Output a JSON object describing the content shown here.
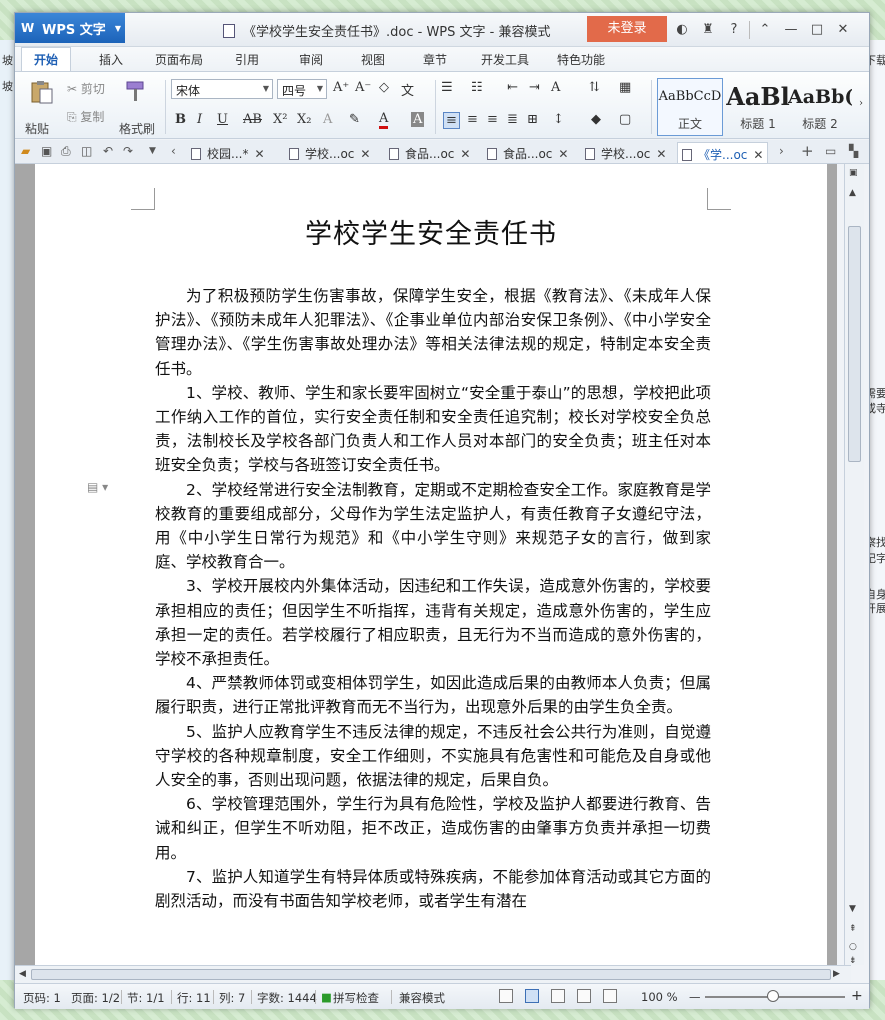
{
  "desktop": {
    "left_strip": [
      "坡",
      "坡"
    ],
    "right_strip": [
      "下载",
      "需要",
      "或寺",
      "察找",
      "记字",
      "自身",
      "开展"
    ]
  },
  "titlebar": {
    "app_name": "WPS 文字",
    "document_title": "《学校学生安全责任书》.doc - WPS 文字 - 兼容模式",
    "login_button": "未登录",
    "help_label": "?"
  },
  "menu": {
    "tabs": [
      "开始",
      "插入",
      "页面布局",
      "引用",
      "审阅",
      "视图",
      "章节",
      "开发工具",
      "特色功能"
    ],
    "active_tab": "开始"
  },
  "ribbon": {
    "paste": "粘贴",
    "cut": "剪切",
    "copy": "复制",
    "format_painter": "格式刷",
    "font_name": "宋体",
    "font_size": "四号",
    "styles": [
      {
        "sample": "AaBbCcD",
        "name": "正文"
      },
      {
        "sample": "AaBl",
        "name": "标题 1"
      },
      {
        "sample": "AaBb(",
        "name": "标题 2"
      }
    ]
  },
  "doc_tabs": [
    {
      "label": "校园...*",
      "active": false
    },
    {
      "label": "学校...oc",
      "active": false
    },
    {
      "label": "食品...oc",
      "active": false
    },
    {
      "label": "食品...oc",
      "active": false
    },
    {
      "label": "学校...oc",
      "active": false
    },
    {
      "label": "《学...oc",
      "active": true
    }
  ],
  "document": {
    "title": "学校学生安全责任书",
    "paragraphs": [
      "为了积极预防学生伤害事故，保障学生安全，根据《教育法》、《未成年人保护法》、《预防未成年人犯罪法》、《企事业单位内部治安保卫条例》、《中小学安全管理办法》、《学生伤害事故处理办法》等相关法律法规的规定，特制定本安全责任书。",
      "1、学校、教师、学生和家长要牢固树立“安全重于泰山”的思想，学校把此项工作纳入工作的首位，实行安全责任制和安全责任追究制；校长对学校安全负总责，法制校长及学校各部门负责人和工作人员对本部门的安全负责；班主任对本班安全负责；学校与各班签订安全责任书。",
      "2、学校经常进行安全法制教育，定期或不定期检查安全工作。家庭教育是学校教育的重要组成部分，父母作为学生法定监护人，有责任教育子女遵纪守法，用《中小学生日常行为规范》和《中小学生守则》来规范子女的言行，做到家庭、学校教育合一。",
      "3、学校开展校内外集体活动，因违纪和工作失误，造成意外伤害的，学校要承担相应的责任；但因学生不听指挥，违背有关规定，造成意外伤害的，学生应承担一定的责任。若学校履行了相应职责，且无行为不当而造成的意外伤害的，学校不承担责任。",
      "4、严禁教师体罚或变相体罚学生，如因此造成后果的由教师本人负责；但属履行职责，进行正常批评教育而无不当行为，出现意外后果的由学生负全责。",
      "5、监护人应教育学生不违反法律的规定，不违反社会公共行为准则，自觉遵守学校的各种规章制度，安全工作细则，不实施具有危害性和可能危及自身或他人安全的事，否则出现问题，依据法律的规定，后果自负。",
      "6、学校管理范围外，学生行为具有危险性，学校及监护人都要进行教育、告诫和纠正，但学生不听劝阻，拒不改正，造成伤害的由肇事方负责并承担一切费用。",
      "7、监护人知道学生有特异体质或特殊疾病，不能参加体育活动或其它方面的剧烈活动，而没有书面告知学校老师，或者学生有潜在"
    ]
  },
  "status": {
    "page_no": "页码: 1",
    "pages": "页面: 1/2",
    "section": "节: 1/1",
    "line": "行: 11",
    "column": "列: 7",
    "word_count": "字数: 1444",
    "spellcheck": "拼写检查",
    "mode": "兼容模式",
    "zoom": "100 %"
  },
  "colors": {
    "app_button": "#1c63b9",
    "login_button": "#e26a4a",
    "active_tab_text": "#1e5fb4"
  }
}
